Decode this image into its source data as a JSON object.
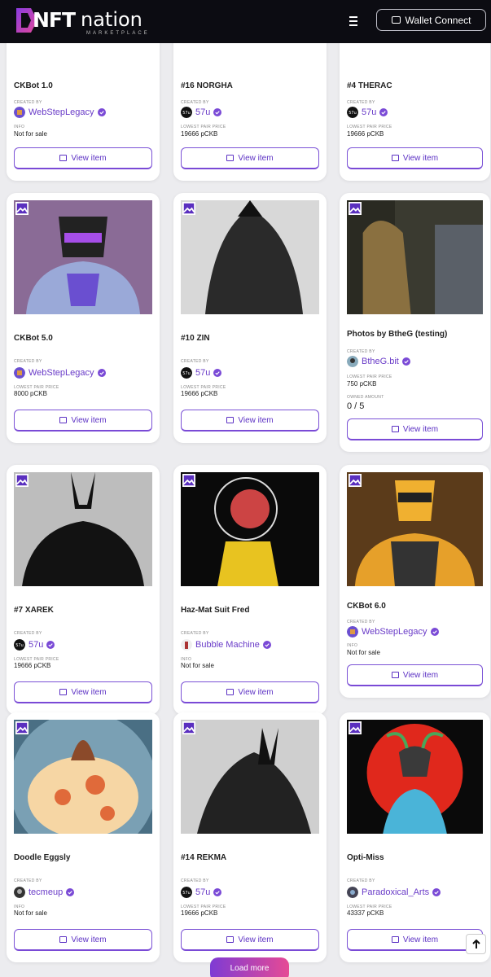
{
  "header": {
    "logo_nft": "NFT",
    "logo_nation": "nation",
    "logo_sub": "MARKETPLACE",
    "wallet_label": "Wallet Connect"
  },
  "cards": [
    {
      "title": "CKBot 1.0",
      "created_label": "CREATED BY",
      "creator": "WebStepLegacy",
      "info_label": "INFO",
      "info_value": "Not for sale",
      "button": "View item"
    },
    {
      "title": "#16 NORGHA",
      "created_label": "CREATED BY",
      "creator": "57u",
      "info_label": "LOWEST PAIR PRICE",
      "info_value": "19666 pCKB",
      "button": "View item"
    },
    {
      "title": "#4 THERAC",
      "created_label": "CREATED BY",
      "creator": "57u",
      "info_label": "LOWEST PAIR PRICE",
      "info_value": "19666 pCKB",
      "button": "View item"
    },
    {
      "title": "CKBot 5.0",
      "created_label": "CREATED BY",
      "creator": "WebStepLegacy",
      "info_label": "LOWEST PAIR PRICE",
      "info_value": "8000 pCKB",
      "button": "View item"
    },
    {
      "title": "#10 ZIN",
      "created_label": "CREATED BY",
      "creator": "57u",
      "info_label": "LOWEST PAIR PRICE",
      "info_value": "19666 pCKB",
      "button": "View item"
    },
    {
      "title": "Photos by BtheG (testing)",
      "created_label": "CREATED BY",
      "creator": "BtheG.bit",
      "info_label": "LOWEST PAIR PRICE",
      "info_value": "750 pCKB",
      "owned_label": "OWNED AMOUNT",
      "owned_value": "0 / 5",
      "button": "View item"
    },
    {
      "title": "#7 XAREK",
      "created_label": "CREATED BY",
      "creator": "57u",
      "info_label": "LOWEST PAIR PRICE",
      "info_value": "19666 pCKB",
      "button": "View item"
    },
    {
      "title": "Haz-Mat Suit Fred",
      "created_label": "CREATED BY",
      "creator": "Bubble Machine",
      "info_label": "INFO",
      "info_value": "Not for sale",
      "button": "View item"
    },
    {
      "title": "CKBot 6.0",
      "created_label": "CREATED BY",
      "creator": "WebStepLegacy",
      "info_label": "INFO",
      "info_value": "Not for sale",
      "button": "View item"
    },
    {
      "title": "Doodle Eggsly",
      "created_label": "CREATED BY",
      "creator": "tecmeup",
      "info_label": "INFO",
      "info_value": "Not for sale",
      "button": "View item"
    },
    {
      "title": "#14 REKMA",
      "created_label": "CREATED BY",
      "creator": "57u",
      "info_label": "LOWEST PAIR PRICE",
      "info_value": "19666 pCKB",
      "button": "View item"
    },
    {
      "title": "Opti-Miss",
      "created_label": "CREATED BY",
      "creator": "Paradoxical_Arts",
      "info_label": "LOWEST PAIR PRICE",
      "info_value": "43337 pCKB",
      "button": "View item"
    }
  ],
  "load_more": "Load more",
  "colors": {
    "accent": "#6a3cc8",
    "header_bg": "#0c0c12",
    "page_bg": "#ececef"
  },
  "icons": [
    "hamburger-menu-icon",
    "wallet-icon",
    "image-icon",
    "verified-badge-icon",
    "shopping-bag-icon",
    "arrow-up-icon"
  ]
}
